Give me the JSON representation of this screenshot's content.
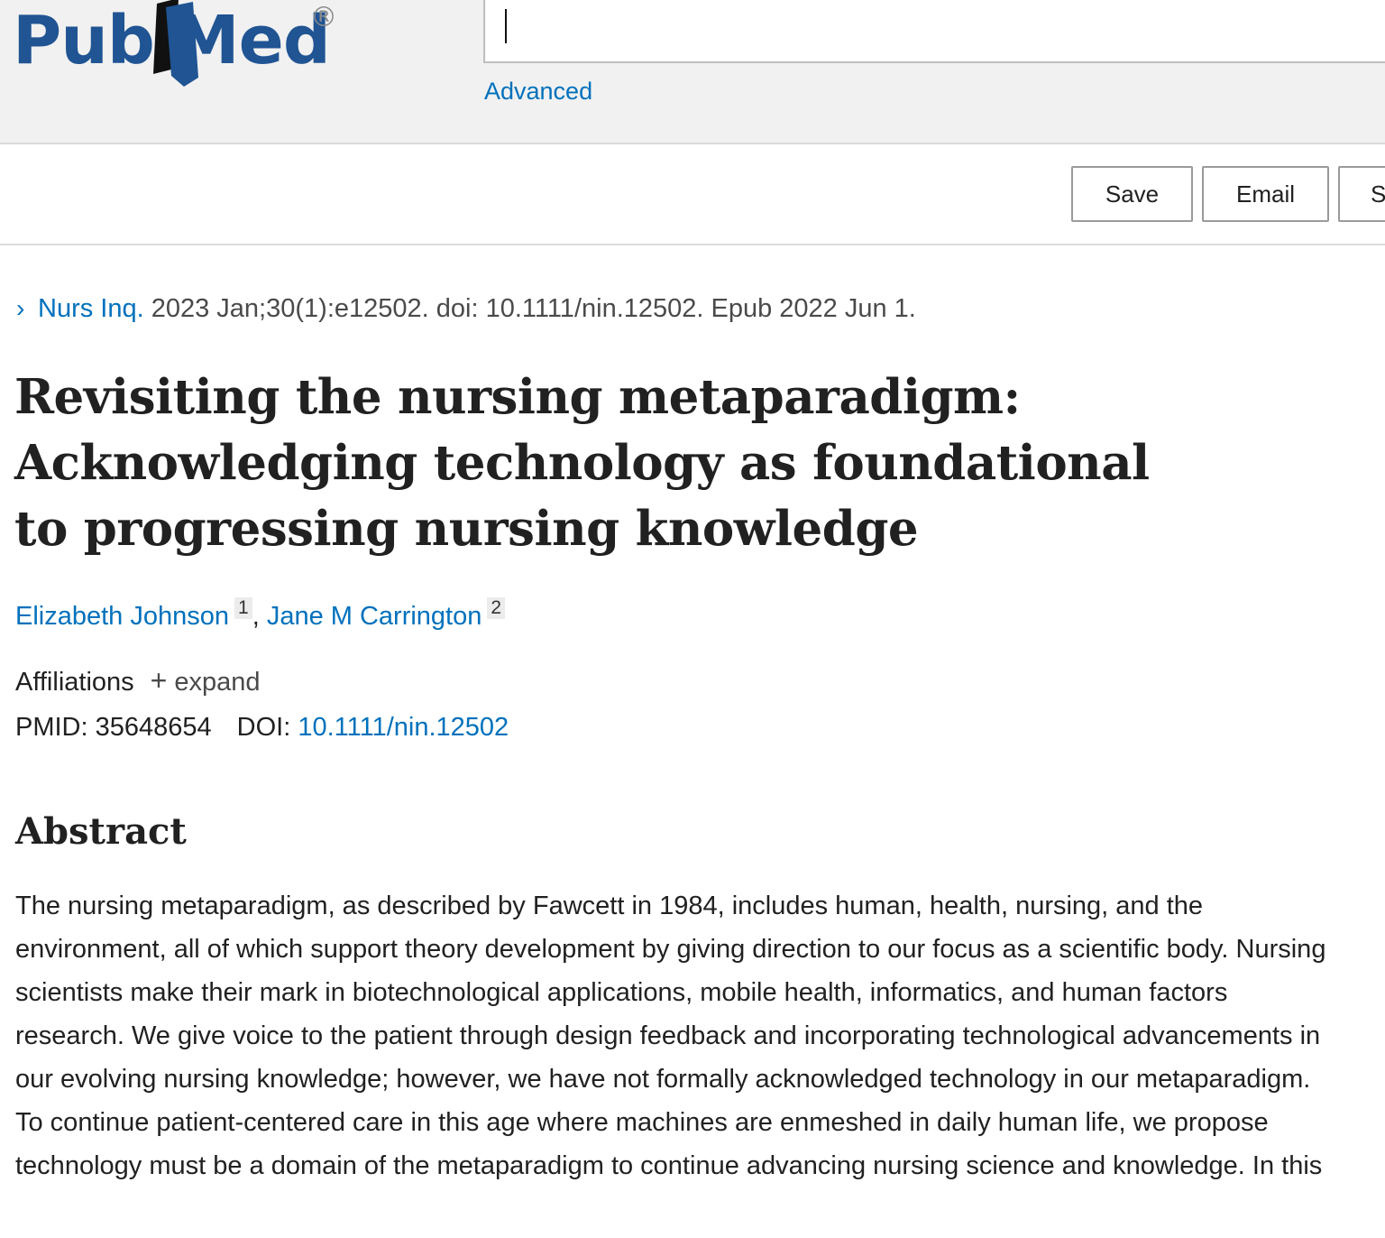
{
  "header": {
    "logo": {
      "left": "Pub",
      "right": "Med",
      "registered": "®"
    },
    "search": {
      "value": "",
      "placeholder": ""
    },
    "advanced_label": "Advanced"
  },
  "toolbar": {
    "save_label": "Save",
    "email_label": "Email",
    "send_label": "S"
  },
  "article": {
    "journal": "Nurs Inq.",
    "citation": " 2023 Jan;30(1):e12502. doi: 10.1111/nin.12502. Epub 2022 Jun 1.",
    "title": "Revisiting the nursing metaparadigm: Acknowledging technology as foundational to progressing nursing knowledge",
    "authors": [
      {
        "name": "Elizabeth Johnson",
        "aff": "1"
      },
      {
        "name": "Jane M Carrington",
        "aff": "2"
      }
    ],
    "author_separator": ", ",
    "affiliations_label": "Affiliations",
    "expand_label": "expand",
    "pmid_label": "PMID: 35648654",
    "doi_label": "DOI:",
    "doi_value": "10.1111/nin.12502"
  },
  "abstract": {
    "heading": "Abstract",
    "text": "The nursing metaparadigm, as described by Fawcett in 1984, includes human, health, nursing, and the environment, all of which support theory development by giving direction to our focus as a scientific body. Nursing scientists make their mark in biotechnological applications, mobile health, informatics, and human factors research. We give voice to the patient through design feedback and incorporating technological advancements in our evolving nursing knowledge; however, we have not formally acknowledged technology in our metaparadigm. To continue patient-centered care in this age where machines are enmeshed in daily human life, we propose technology must be a domain of the metaparadigm to continue advancing nursing science and knowledge. In this"
  },
  "colors": {
    "brand": "#205493",
    "link": "#0071bc",
    "header_bg": "#f1f1f1",
    "text": "#212121"
  }
}
